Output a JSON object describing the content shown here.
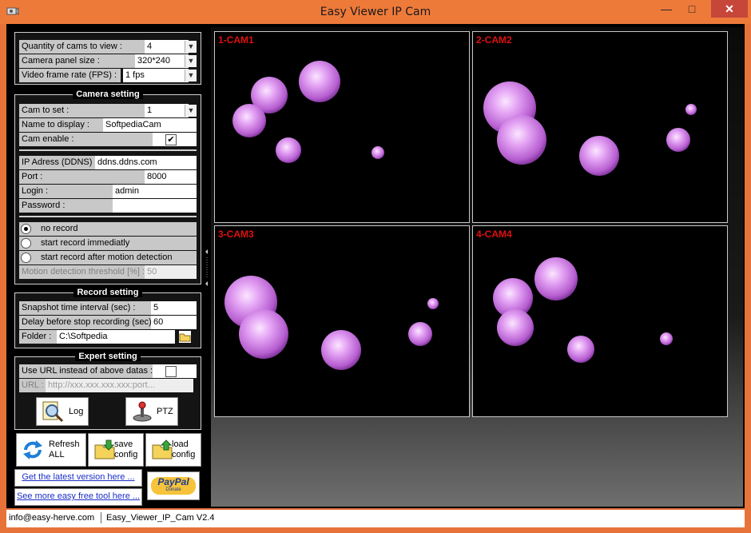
{
  "window": {
    "title": "Easy Viewer IP Cam"
  },
  "view_settings": {
    "quantity_label": "Quantity of cams to view :",
    "quantity_value": "4",
    "panel_size_label": "Camera panel size :",
    "panel_size_value": "320*240",
    "fps_label": "Video frame rate (FPS) :",
    "fps_value": "1 fps"
  },
  "camera_setting": {
    "group_title": "Camera setting",
    "cam_to_set_label": "Cam to set :",
    "cam_to_set_value": "1",
    "name_label": "Name to display :",
    "name_value": "SoftpediaCam",
    "enable_label": "Cam enable :",
    "enable_checked": "✔",
    "ip_label": "IP Adress (DDNS) :",
    "ip_value": "ddns.ddns.com",
    "port_label": "Port :",
    "port_value": "8000",
    "login_label": "Login :",
    "login_value": "admin",
    "password_label": "Password :",
    "password_value": "",
    "record_options": [
      "no record",
      "start record immediatly",
      "start record after motion detection"
    ],
    "threshold_label": "Motion detection threshold [%] :",
    "threshold_value": "50"
  },
  "record_setting": {
    "group_title": "Record setting",
    "snapshot_label": "Snapshot time interval (sec) :",
    "snapshot_value": "5",
    "delay_label": "Delay before stop recording (sec) :",
    "delay_value": "60",
    "folder_label": "Folder :",
    "folder_value": "C:\\Softpedia"
  },
  "expert_setting": {
    "group_title": "Expert setting",
    "use_url_label": "Use URL instead of above datas :",
    "url_label": "URL :",
    "url_placeholder": "http://xxx.xxx.xxx.xxx:port...",
    "log_label": "Log",
    "ptz_label": "PTZ"
  },
  "actions": {
    "refresh_label_1": "Refresh",
    "refresh_label_2": "ALL",
    "save_label_1": "save",
    "save_label_2": "config",
    "load_label_1": "load",
    "load_label_2": "config"
  },
  "links": {
    "latest_version": "Get the latest version here ...",
    "more_tools": "See more easy free tool here ...",
    "paypal_brand": "PayPal",
    "paypal_sub": "Donate"
  },
  "cameras": [
    {
      "name": "1-CAM1"
    },
    {
      "name": "2-CAM2"
    },
    {
      "name": "3-CAM3"
    },
    {
      "name": "4-CAM4"
    }
  ],
  "statusbar": {
    "email": "info@easy-herve.com",
    "version": "Easy_Viewer_IP_Cam V2.4"
  },
  "colors": {
    "titlebar": "#ee7a3a",
    "close_button": "#c7463a",
    "cam_label": "#e01010",
    "bubble": "#d07ee6",
    "link": "#1a2fc8"
  }
}
